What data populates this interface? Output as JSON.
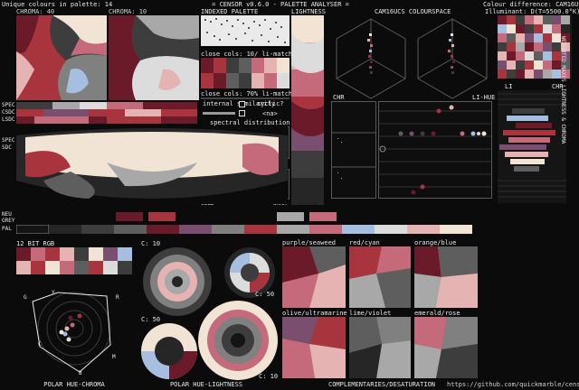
{
  "header": {
    "unique_colours": "Unique colours in palette: 14",
    "title": "= CENSOR v0.6.0 - PALETTE ANALYSER =",
    "colour_difference": "Colour difference: CAM16UCS",
    "illuminant": "Illuminant: D(T=5500.0°K)"
  },
  "labels": {
    "chroma_top": "CHROMA: 40",
    "chroma_mid": "CHROMA: 10",
    "indexed_palette": "INDEXED PALETTE",
    "lightness_left": "LIGHTNESS",
    "cam_space": "CAM16UCS COLOURSPACE",
    "lightness_rot": "LIGHTNESS",
    "spec": "SPEC",
    "csdc": "CSDC",
    "lsdc": "LSDC",
    "spec2": "SPEC",
    "sdc": "SDC",
    "neu": "NEU",
    "grey": "GREY",
    "pal": "PAL",
    "close_cols_1": "close cols: 10/ li-match",
    "close_cols_2": "close cols: 70% li-match",
    "internal_similarity": "internal similarity",
    "cyclic": "cyclic?",
    "na": "<na>",
    "spectral_distribution": "spectral distribution",
    "spec_min": "4400",
    "spec_max": "6630",
    "temperature": "temperature",
    "cold": "COLD",
    "warm": "WARM",
    "chr": "CHR",
    "li_hue": "LI-HUE",
    "li": "LI",
    "chr2": "CHR",
    "rot_right": "WEIGHTED MAXES  LIGHTNESS & CHROMA",
    "bit_rgb": "12 BIT RGB",
    "c10a": "C: 10",
    "c50a": "C: 50",
    "c50b": "C: 50",
    "c10b": "C: 10",
    "comp_labels": [
      "purple/seaweed",
      "red/cyan",
      "orange/blue",
      "olive/ultramarine",
      "lime/violet",
      "emerald/rose"
    ],
    "polar_hue_chroma": "POLAR HUE-CHROMA",
    "polar_hue_lightness": "POLAR HUE-LIGHTNESS",
    "complementaries": "COMPLEMENTARIES/DESATURATION",
    "url": "https://github.com/quickmarble/censor",
    "hue_letters": [
      "G",
      "Y",
      "R",
      "C",
      "M",
      "B"
    ]
  },
  "palette": [
    "#141414",
    "#262626",
    "#3d3d3d",
    "#5e5e5e",
    "#808080",
    "#a8a8a8",
    "#dcdcdc",
    "#6b1a2a",
    "#a8353e",
    "#c46a7a",
    "#e6b3b3",
    "#f2e4d4",
    "#a6bfe0",
    "#7a4e6e"
  ],
  "colors": {
    "accent_border": "#5a5a5a",
    "background": "#0b0b0b"
  }
}
